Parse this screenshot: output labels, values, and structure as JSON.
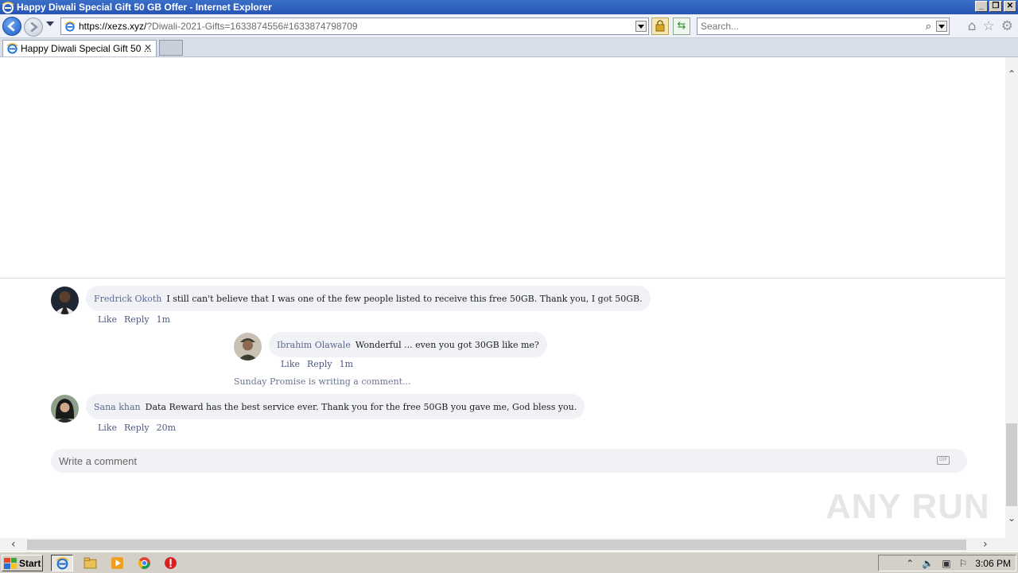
{
  "window": {
    "title": "Happy Diwali Special Gift 50 GB Offer - Internet Explorer",
    "controls": [
      "_",
      "❐",
      "✕"
    ]
  },
  "nav": {
    "url_host": "https://xezs.xyz/",
    "url_rest": "?Diwali-2021-Gifts=1633874556#1633874798709",
    "search_placeholder": "Search..."
  },
  "tabs": [
    {
      "label": "Happy Diwali Special Gift 50 ...",
      "close": "✕"
    }
  ],
  "comments": [
    {
      "author": "Fredrick Okoth",
      "text": "I still can't believe that I was one of the few people listed to receive this free 50GB. Thank you, I got 50GB.",
      "like": "Like",
      "reply": "Reply",
      "time": "1m"
    },
    {
      "author": "Ibrahim Olawale",
      "text": "Wonderful ... even you got 30GB like me?",
      "like": "Like",
      "reply": "Reply",
      "time": "1m"
    },
    {
      "author": "Sana khan",
      "text": "Data Reward has the best service ever. Thank you for the free 50GB you gave me, God bless you.",
      "like": "Like",
      "reply": "Reply",
      "time": "20m"
    }
  ],
  "typing_indicator": "Sunday Promise is writing a comment...",
  "write_comment": {
    "placeholder": "Write a comment",
    "gif": "GIF"
  },
  "watermark": "ANY RUN",
  "taskbar": {
    "start_label": "Start",
    "clock": "3:06 PM"
  }
}
